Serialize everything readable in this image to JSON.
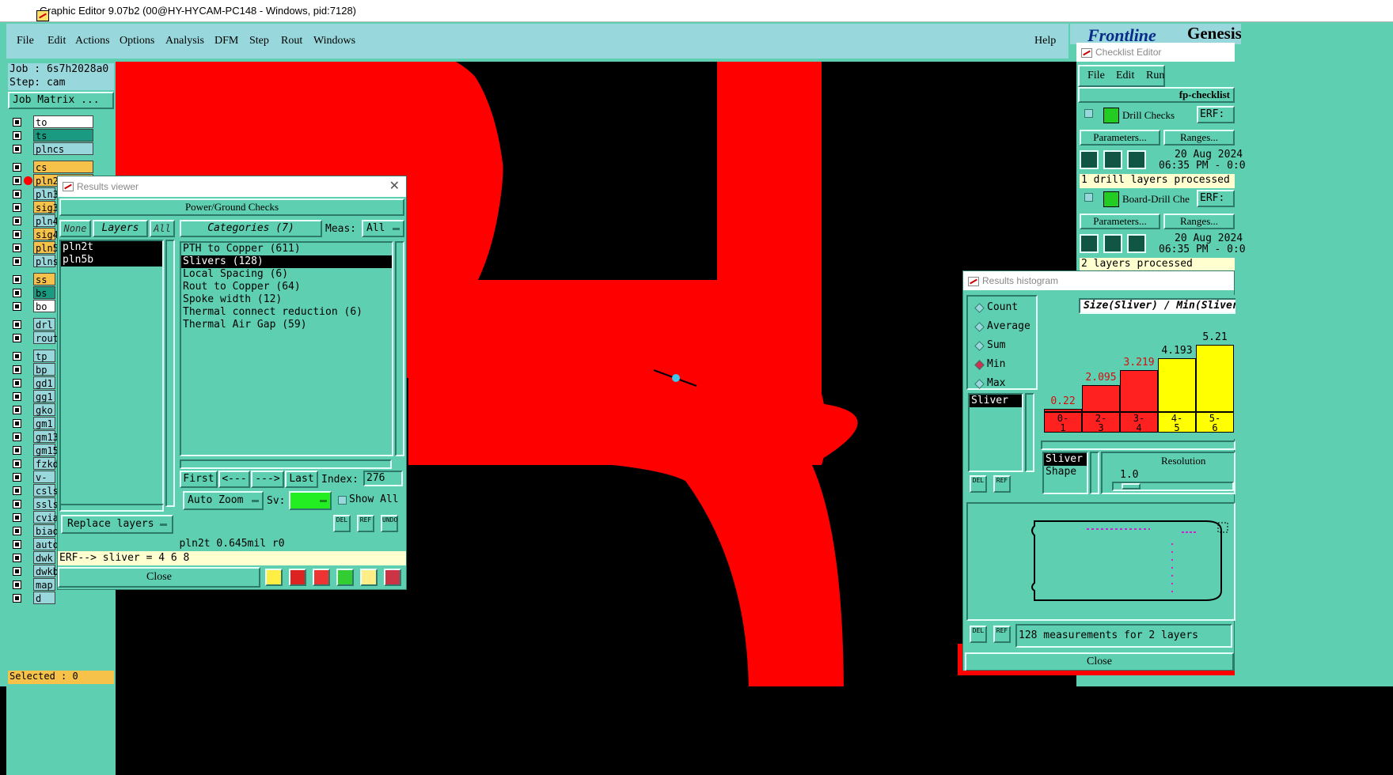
{
  "window": {
    "title": "Graphic Editor 9.07b2 (00@HY-HYCAM-PC148 - Windows, pid:7128)"
  },
  "menu": {
    "items": [
      "File",
      "Edit",
      "Actions",
      "Options",
      "Analysis",
      "DFM",
      "Step",
      "Rout",
      "Windows"
    ],
    "help": "Help"
  },
  "brand": {
    "left": "Frontline",
    "right": "Genesis"
  },
  "job": {
    "job": "Job : 6s7h2028a0",
    "step": "Step: cam",
    "matrix_button": "Job Matrix ..."
  },
  "layers": [
    {
      "name": "to",
      "color": "#ffffff"
    },
    {
      "name": "ts",
      "color": "#1a9a80"
    },
    {
      "name": "plncs",
      "color": "#98d8dc"
    },
    {
      "name": "cs",
      "color": "#f7c24a"
    },
    {
      "name": "pln2t",
      "color": "#f7c24a"
    },
    {
      "name": "pln3",
      "color": "#98d8dc"
    },
    {
      "name": "sig3",
      "color": "#f7c24a"
    },
    {
      "name": "pln4",
      "color": "#98d8dc"
    },
    {
      "name": "sig4",
      "color": "#f7c24a"
    },
    {
      "name": "pln5",
      "color": "#f7c24a"
    },
    {
      "name": "plns",
      "color": "#98d8dc"
    },
    {
      "name": "ss",
      "color": "#f7c24a"
    },
    {
      "name": "bs",
      "color": "#1a9a80"
    },
    {
      "name": "bo",
      "color": "#ffffff"
    },
    {
      "name": "drl",
      "color": "#98d8dc"
    },
    {
      "name": "rout",
      "color": "#98d8dc"
    },
    {
      "name": "tp",
      "color": "#98d8dc"
    },
    {
      "name": "bp",
      "color": "#98d8dc"
    },
    {
      "name": "gd1",
      "color": "#98d8dc"
    },
    {
      "name": "gg1",
      "color": "#98d8dc"
    },
    {
      "name": "gko",
      "color": "#98d8dc"
    },
    {
      "name": "gm1",
      "color": "#98d8dc"
    },
    {
      "name": "gm13",
      "color": "#98d8dc"
    },
    {
      "name": "gm15",
      "color": "#98d8dc"
    },
    {
      "name": "fzkd",
      "color": "#98d8dc"
    },
    {
      "name": "v-cu",
      "color": "#98d8dc"
    },
    {
      "name": "csls",
      "color": "#98d8dc"
    },
    {
      "name": "ssls",
      "color": "#98d8dc"
    },
    {
      "name": "cvia",
      "color": "#98d8dc"
    },
    {
      "name": "biao",
      "color": "#98d8dc"
    },
    {
      "name": "auto",
      "color": "#98d8dc"
    },
    {
      "name": "dwk",
      "color": "#98d8dc"
    },
    {
      "name": "dwkb",
      "color": "#98d8dc"
    },
    {
      "name": "map",
      "color": "#98d8dc"
    },
    {
      "name": "d",
      "color": "#98d8dc"
    }
  ],
  "status": {
    "selected": "Selected : 0"
  },
  "results_viewer": {
    "title": "Results viewer",
    "header": "Power/Ground Checks",
    "layer_buttons": {
      "none": "None",
      "layers": "Layers",
      "all": "All"
    },
    "layer_list": [
      "pln2t",
      "pln5b"
    ],
    "categories_label": "Categories (7)",
    "meas_label": "Meas:",
    "meas_value": "All",
    "categories": [
      "PTH to Copper (611)",
      "Slivers (128)",
      "Local Spacing (6)",
      "Rout to Copper (64)",
      "Spoke width (12)",
      "Thermal connect reduction (6)",
      "Thermal Air Gap (59)"
    ],
    "selected_category": 1,
    "nav": {
      "first": "First",
      "prev": "<---",
      "next": "--->",
      "last": "Last",
      "index_label": "Index:",
      "index_value": "276"
    },
    "auto_zoom": "Auto Zoom",
    "sv_label": "Sv:",
    "show_all": "Show All",
    "replace_layers": "Replace layers",
    "icon_del": "DEL",
    "icon_ref": "REF",
    "icon_undo": "UNDO",
    "status_line": "pln2t 0.645mil  r0",
    "erf_line": "ERF--> sliver = 4 6 8",
    "close": "Close"
  },
  "checklist": {
    "title": "Checklist Editor",
    "menu": [
      "File",
      "Edit",
      "Run"
    ],
    "name": "fp-checklist",
    "checks": [
      {
        "name": "Drill Checks",
        "erf": "ERF:",
        "params": "Parameters...",
        "ranges": "Ranges...",
        "date": "20 Aug 2024",
        "time": "06:35 PM - 0:0",
        "status": "1 drill layers processed"
      },
      {
        "name": "Board-Drill Che",
        "erf": "ERF:",
        "params": "Parameters...",
        "ranges": "Ranges...",
        "date": "20 Aug 2024",
        "time": "06:35 PM - 0:0",
        "status": "2 layers processed"
      }
    ]
  },
  "histogram": {
    "title": "Results histogram",
    "options": [
      "Count",
      "Average",
      "Sum",
      "Min",
      "Max"
    ],
    "selected_option": "Min",
    "category": "Sliver",
    "heading": "Size(Sliver) / Min(Sliver",
    "bars": [
      {
        "value": 0.22,
        "label": "0.22",
        "bin": "0-\n1",
        "color": "#ff2020"
      },
      {
        "value": 2.095,
        "label": "2.095",
        "bin": "2-\n3",
        "color": "#ff2020"
      },
      {
        "value": 3.219,
        "label": "3.219",
        "bin": "3-\n4",
        "color": "#ff2020"
      },
      {
        "value": 4.193,
        "label": "4.193",
        "bin": "4-\n5",
        "color": "#ffff00"
      },
      {
        "value": 5.21,
        "label": "5.21",
        "bin": "5-\n6",
        "color": "#ffff00"
      }
    ],
    "ymax": 6,
    "resolution_label": "Resolution",
    "resolution_value": "1.0",
    "shape_list": [
      "Sliver",
      "Shape"
    ],
    "summary": "128 measurements for 2 layers",
    "close": "Close",
    "icon_del": "DEL",
    "icon_ref": "REF"
  },
  "colors": {
    "copper": "#ff0000",
    "background": "#000000",
    "panel": "#5fcfb2",
    "field": "#98d8dc"
  }
}
